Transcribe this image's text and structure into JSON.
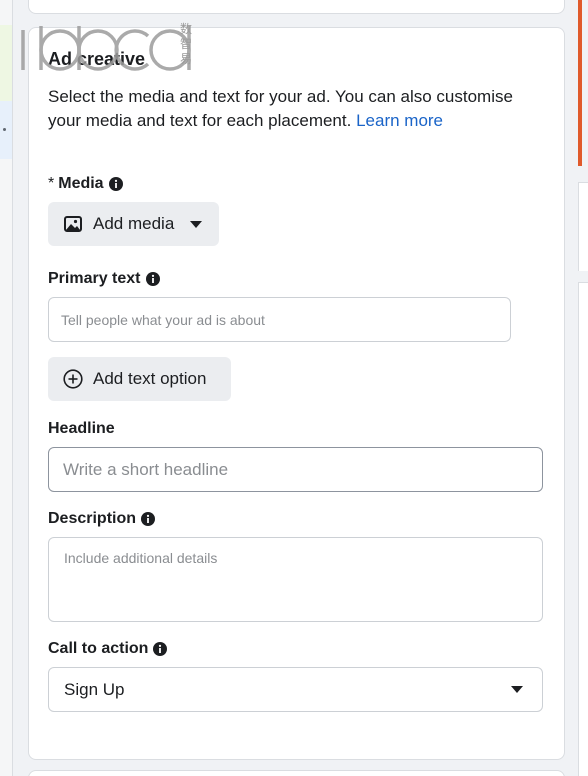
{
  "watermark": {
    "text": "iabcd",
    "cjk": "数智易"
  },
  "ad_creative": {
    "title": "Ad creative",
    "description": "Select the media and text for your ad. You can also customise your media and text for each placement.",
    "learn_more": "Learn more",
    "media": {
      "required_mark": "*",
      "label": "Media",
      "info_icon": "info-icon",
      "add_button": "Add media",
      "add_icon": "image-icon"
    },
    "primary_text": {
      "label": "Primary text",
      "info_icon": "info-icon",
      "placeholder": "Tell people what your ad is about",
      "add_option_button": "Add text option",
      "add_option_icon": "plus-circle-icon"
    },
    "headline": {
      "label": "Headline",
      "placeholder": "Write a short headline"
    },
    "description_field": {
      "label": "Description",
      "info_icon": "info-icon",
      "placeholder": "Include additional details"
    },
    "call_to_action": {
      "label": "Call to action",
      "info_icon": "info-icon",
      "selected": "Sign Up"
    }
  },
  "colors": {
    "link": "#1a64c8",
    "button_bg": "#ebedf0",
    "border": "#ccd0d5",
    "accent_orange": "#e05a2b"
  }
}
